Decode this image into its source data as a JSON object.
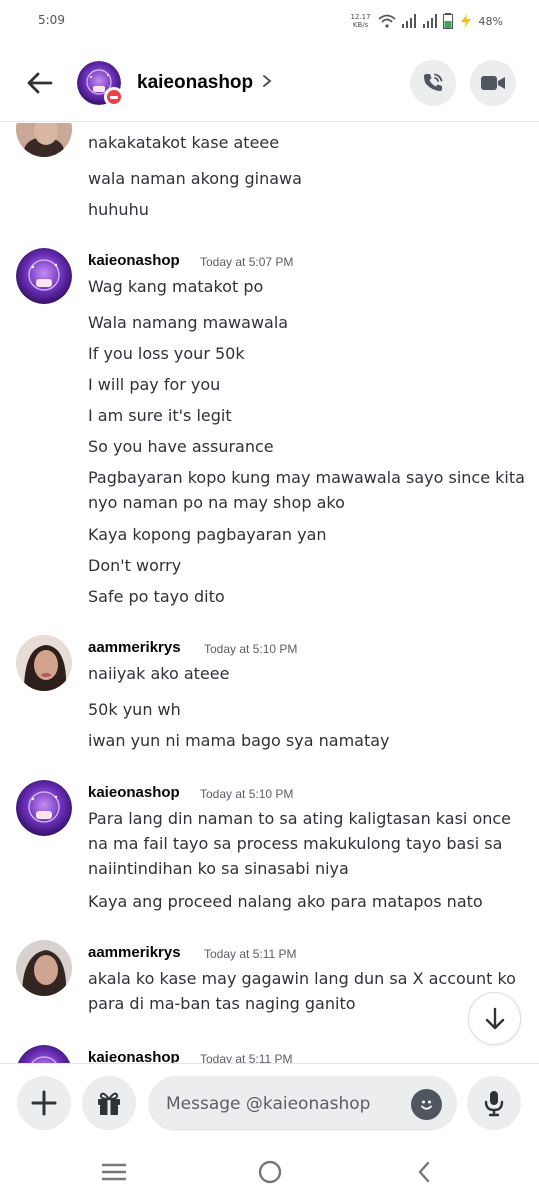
{
  "status_bar": {
    "time": "5:09",
    "net_speed_value": "12.17",
    "net_speed_unit": "KB/s",
    "battery": "48%"
  },
  "header": {
    "channel_name": "kaieonashop",
    "avatar_status": "do-not-disturb",
    "icons": {
      "back": "arrow-left-icon",
      "chevron": "chevron-right-icon",
      "call": "phone-call-icon",
      "video": "video-camera-icon"
    }
  },
  "messages": [
    {
      "author": "",
      "time": "",
      "lines": [
        "nakakatakot kase ateee",
        "wala naman akong ginawa",
        "huhuhu"
      ]
    },
    {
      "author": "kaieonashop",
      "time": "Today at 5:07 PM",
      "lines": [
        "Wag kang matakot po",
        "Wala namang mawawala",
        "If you loss your 50k",
        "I will pay for you",
        "I am sure it's legit",
        "So you have assurance",
        "Pagbayaran kopo kung may mawawala sayo since kita nyo naman po na may shop ako",
        "Kaya kopong pagbayaran yan",
        "Don't worry",
        "Safe po tayo dito"
      ]
    },
    {
      "author": "aammerikrys",
      "time": "Today at 5:10 PM",
      "lines": [
        "naiiyak ako ateee",
        "50k yun wh",
        "iwan yun ni mama bago sya namatay"
      ]
    },
    {
      "author": "kaieonashop",
      "time": "Today at 5:10 PM",
      "lines": [
        "Para lang din naman to sa ating kaligtasan kasi once na ma fail tayo sa process makukulong tayo basi sa naiintindihan ko sa sinasabi niya",
        "Kaya ang proceed nalang ako para matapos nato"
      ]
    },
    {
      "author": "aammerikrys",
      "time": "Today at 5:11 PM",
      "lines": [
        "akala ko kase may gagawin lang dun sa X account ko para di ma-ban tas naging ganito"
      ]
    },
    {
      "author": "kaieonashop",
      "time": "Today at 5:11 PM",
      "lines": []
    }
  ],
  "composer": {
    "placeholder": "Message @kaieonashop",
    "icons": {
      "plus": "plus-icon",
      "gift": "gift-icon",
      "emoji": "emoji-icon",
      "mic": "microphone-icon",
      "scroll_down": "arrow-down-icon"
    }
  },
  "nav": {
    "icons": [
      "recents-icon",
      "home-icon",
      "back-icon"
    ]
  },
  "colors": {
    "accent_purple": "#6a2fb8",
    "dnd_red": "#ed4245",
    "button_bg": "#ebedef",
    "text_dark": "#060607",
    "text_body": "#2e3338",
    "timestamp_gray": "#5c5e66"
  }
}
